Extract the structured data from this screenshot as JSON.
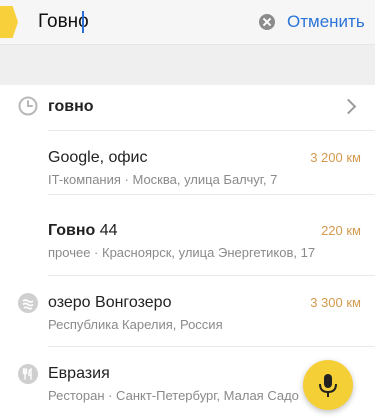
{
  "search": {
    "query": "Говно",
    "cancel_label": "Отменить"
  },
  "results": [
    {
      "icon": "history-clock-icon",
      "title": "говно"
    },
    {
      "title": "Google, офис",
      "subtitle": "IT-компания · Москва, улица Балчуг, 7",
      "distance": "3 200 км"
    },
    {
      "title_bold": "Говно",
      "title_rest": "44",
      "subtitle": "прочее · Красноярск, улица Энергетиков, 17",
      "distance": "220 км"
    },
    {
      "icon": "lake-icon",
      "title": "озеро Вонгозеро",
      "subtitle": "Республика Карелия, Россия",
      "distance": "3 300 км"
    },
    {
      "icon": "restaurant-icon",
      "title": "Евразия",
      "subtitle": "Ресторан · Санкт-Петербург, Малая Садо"
    }
  ],
  "voice": {
    "icon": "microphone-icon"
  },
  "colors": {
    "accent_yellow": "#f5cf36",
    "link_blue": "#2b74d8",
    "distance_orange": "#d59a4f"
  }
}
